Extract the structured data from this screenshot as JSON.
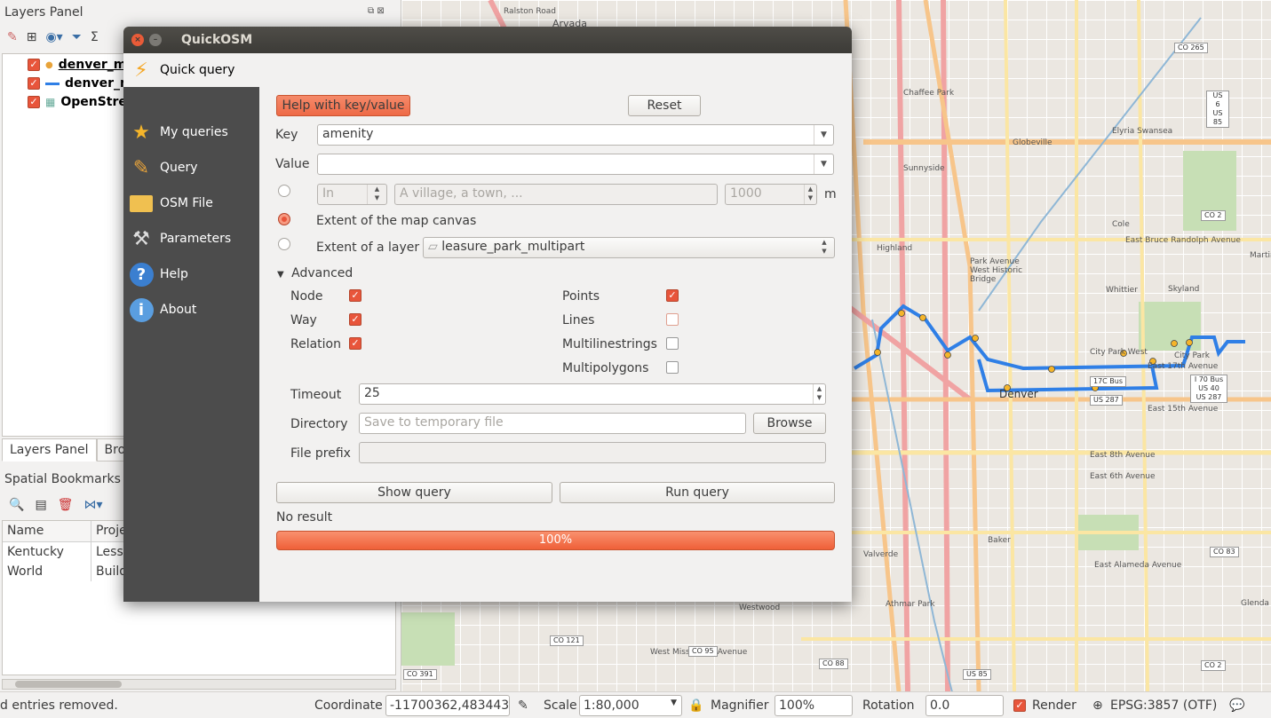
{
  "left_panel": {
    "title": "Layers Panel",
    "layers": [
      {
        "name": "denver_m",
        "icon": "point-icon"
      },
      {
        "name": "denver_m",
        "icon": "line-icon"
      },
      {
        "name": "OpenStre",
        "icon": "raster-icon"
      }
    ],
    "tabs": [
      "Layers Panel",
      "Brow"
    ],
    "bookmarks_title": "Spatial Bookmarks P",
    "bookmarks_columns": [
      "Name",
      "Proje"
    ],
    "bookmarks_rows": [
      {
        "name": "Kentucky",
        "project": "Lesso"
      },
      {
        "name": "World",
        "project": "Build"
      }
    ]
  },
  "status_bar": {
    "message": "d entries removed.",
    "coordinate_label": "Coordinate",
    "coordinate_value": "-11700362,4834436",
    "scale_label": "Scale",
    "scale_value": "1:80,000",
    "magnifier_label": "Magnifier",
    "magnifier_value": "100%",
    "rotation_label": "Rotation",
    "rotation_value": "0.0",
    "render_label": "Render",
    "crs": "EPSG:3857 (OTF)"
  },
  "dialog": {
    "title": "QuickOSM",
    "sidebar": [
      {
        "label": "Quick query",
        "icon": "lightning-icon",
        "active": true
      },
      {
        "label": "My queries",
        "icon": "star-icon",
        "active": false
      },
      {
        "label": "Query",
        "icon": "pencil-icon",
        "active": false
      },
      {
        "label": "OSM File",
        "icon": "folder-icon",
        "active": false
      },
      {
        "label": "Parameters",
        "icon": "tools-icon",
        "active": false
      },
      {
        "label": "Help",
        "icon": "help-icon",
        "active": false
      },
      {
        "label": "About",
        "icon": "info-icon",
        "active": false
      }
    ],
    "help_button": "Help with key/value",
    "reset_button": "Reset",
    "key_label": "Key",
    "key_value": "amenity",
    "value_label": "Value",
    "value_value": "",
    "in_option": "In",
    "place_placeholder": "A village, a town, ...",
    "distance_value": "1000",
    "distance_unit": "m",
    "extent_canvas_label": "Extent of the map canvas",
    "extent_layer_label": "Extent of a layer",
    "extent_layer_value": "leasure_park_multipart",
    "advanced_label": "Advanced",
    "node_label": "Node",
    "way_label": "Way",
    "relation_label": "Relation",
    "points_label": "Points",
    "lines_label": "Lines",
    "multilinestrings_label": "Multilinestrings",
    "multipolygons_label": "Multipolygons",
    "timeout_label": "Timeout",
    "timeout_value": "25",
    "directory_label": "Directory",
    "directory_placeholder": "Save to temporary file",
    "browse_button": "Browse",
    "prefix_label": "File prefix",
    "show_query_button": "Show query",
    "run_query_button": "Run query",
    "result_text": "No result",
    "progress_text": "100%",
    "progress": 1.0
  },
  "map_labels": [
    "Arvada",
    "Ralston Road",
    "Chaffee Park",
    "Sunnyside",
    "Globeville",
    "Elyria Swansea",
    "Highland",
    "Park Avenue West Historic Bridge",
    "Cole",
    "Whittier",
    "Skyland",
    "City Park West",
    "City Park",
    "Denver",
    "Baker",
    "Valverde",
    "Athmar Park",
    "Westwood",
    "Glenda",
    "East 17th Avenue",
    "East 8th Avenue",
    "East 6th Avenue",
    "East Alameda Avenue",
    "East Bruce Randolph Avenue",
    "East 15th Avenue",
    "Martin",
    "West Mississippi Avenue",
    "17C Bus",
    "US 287",
    "I 70 Bus US 40 US 287"
  ],
  "map_shields": [
    "CO 265",
    "US 6 US 85",
    "CO 2",
    "CO 121",
    "CO 95",
    "CO 88",
    "CO 391",
    "CO 83",
    "US 85",
    "CO 2"
  ]
}
